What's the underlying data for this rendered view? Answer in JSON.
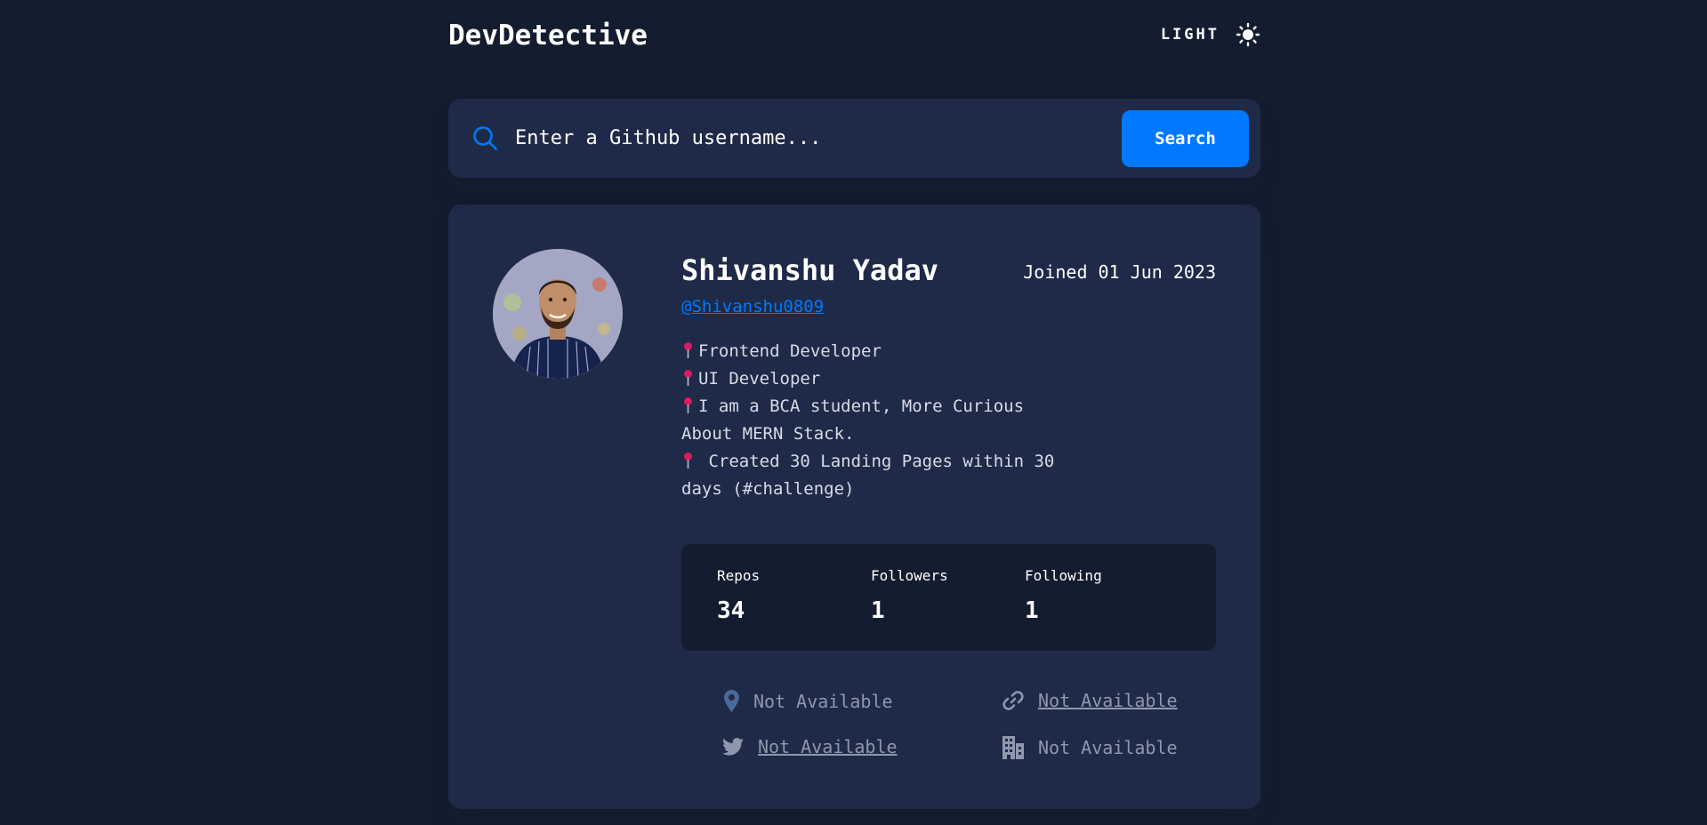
{
  "header": {
    "logo": "DevDetective",
    "mode_label": "LIGHT",
    "mode_icon": "sun-icon"
  },
  "search": {
    "placeholder": "Enter a Github username...",
    "button_label": "Search",
    "icon": "search-icon"
  },
  "profile": {
    "name": "Shivanshu Yadav",
    "joined": "Joined 01 Jun 2023",
    "username": "@Shivanshu0809",
    "bio": [
      {
        "pin": true,
        "text": "Frontend Developer"
      },
      {
        "pin": true,
        "text": "UI Developer"
      },
      {
        "pin": true,
        "text": "I am a BCA student, More Curious"
      },
      {
        "pin": false,
        "text": "About MERN Stack."
      },
      {
        "pin": true,
        "text": " Created 30 Landing Pages within 30"
      },
      {
        "pin": false,
        "text": "days (#challenge)"
      }
    ],
    "stats": {
      "repos_label": "Repos",
      "repos_value": "34",
      "followers_label": "Followers",
      "followers_value": "1",
      "following_label": "Following",
      "following_value": "1"
    },
    "links": {
      "location": {
        "icon": "location-pin-icon",
        "text": "Not Available"
      },
      "website": {
        "icon": "link-icon",
        "text": "Not Available"
      },
      "twitter": {
        "icon": "twitter-icon",
        "text": "Not Available"
      },
      "company": {
        "icon": "building-icon",
        "text": "Not Available"
      }
    }
  },
  "colors": {
    "background": "#141d2f",
    "card": "#1e2a47",
    "accent": "#0079ff",
    "muted": "#8f97ae",
    "pin": "#d81b60"
  }
}
